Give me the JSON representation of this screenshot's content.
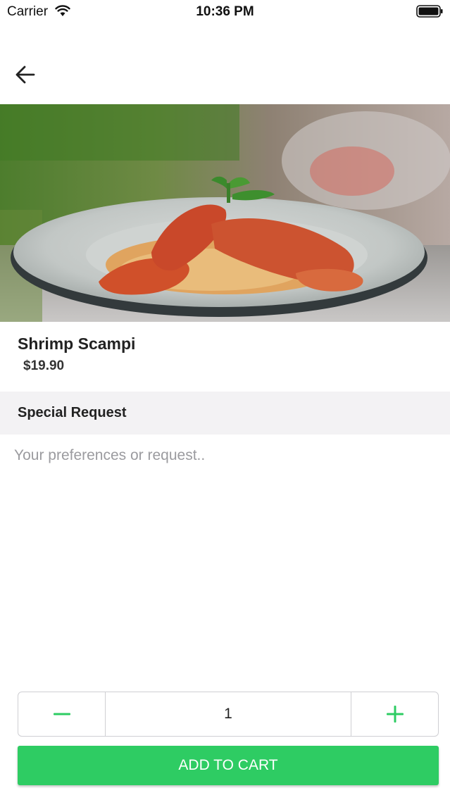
{
  "status_bar": {
    "carrier": "Carrier",
    "time": "10:36 PM",
    "icons": [
      "wifi-icon",
      "battery-icon"
    ]
  },
  "nav": {
    "back_icon": "arrow-left-icon"
  },
  "dish": {
    "image": "shrimp-pasta-photo",
    "name": "Shrimp Scampi",
    "price": "$19.90"
  },
  "special_request": {
    "title": "Special Request",
    "placeholder": "Your preferences or request..",
    "value": ""
  },
  "quantity": {
    "value": "1",
    "decrement_icon": "minus-icon",
    "increment_icon": "plus-icon"
  },
  "cart": {
    "add_label": "ADD TO CART"
  },
  "colors": {
    "accent": "#2ecc63",
    "section_bg": "#f3f2f4",
    "placeholder": "#9b9b9f"
  }
}
